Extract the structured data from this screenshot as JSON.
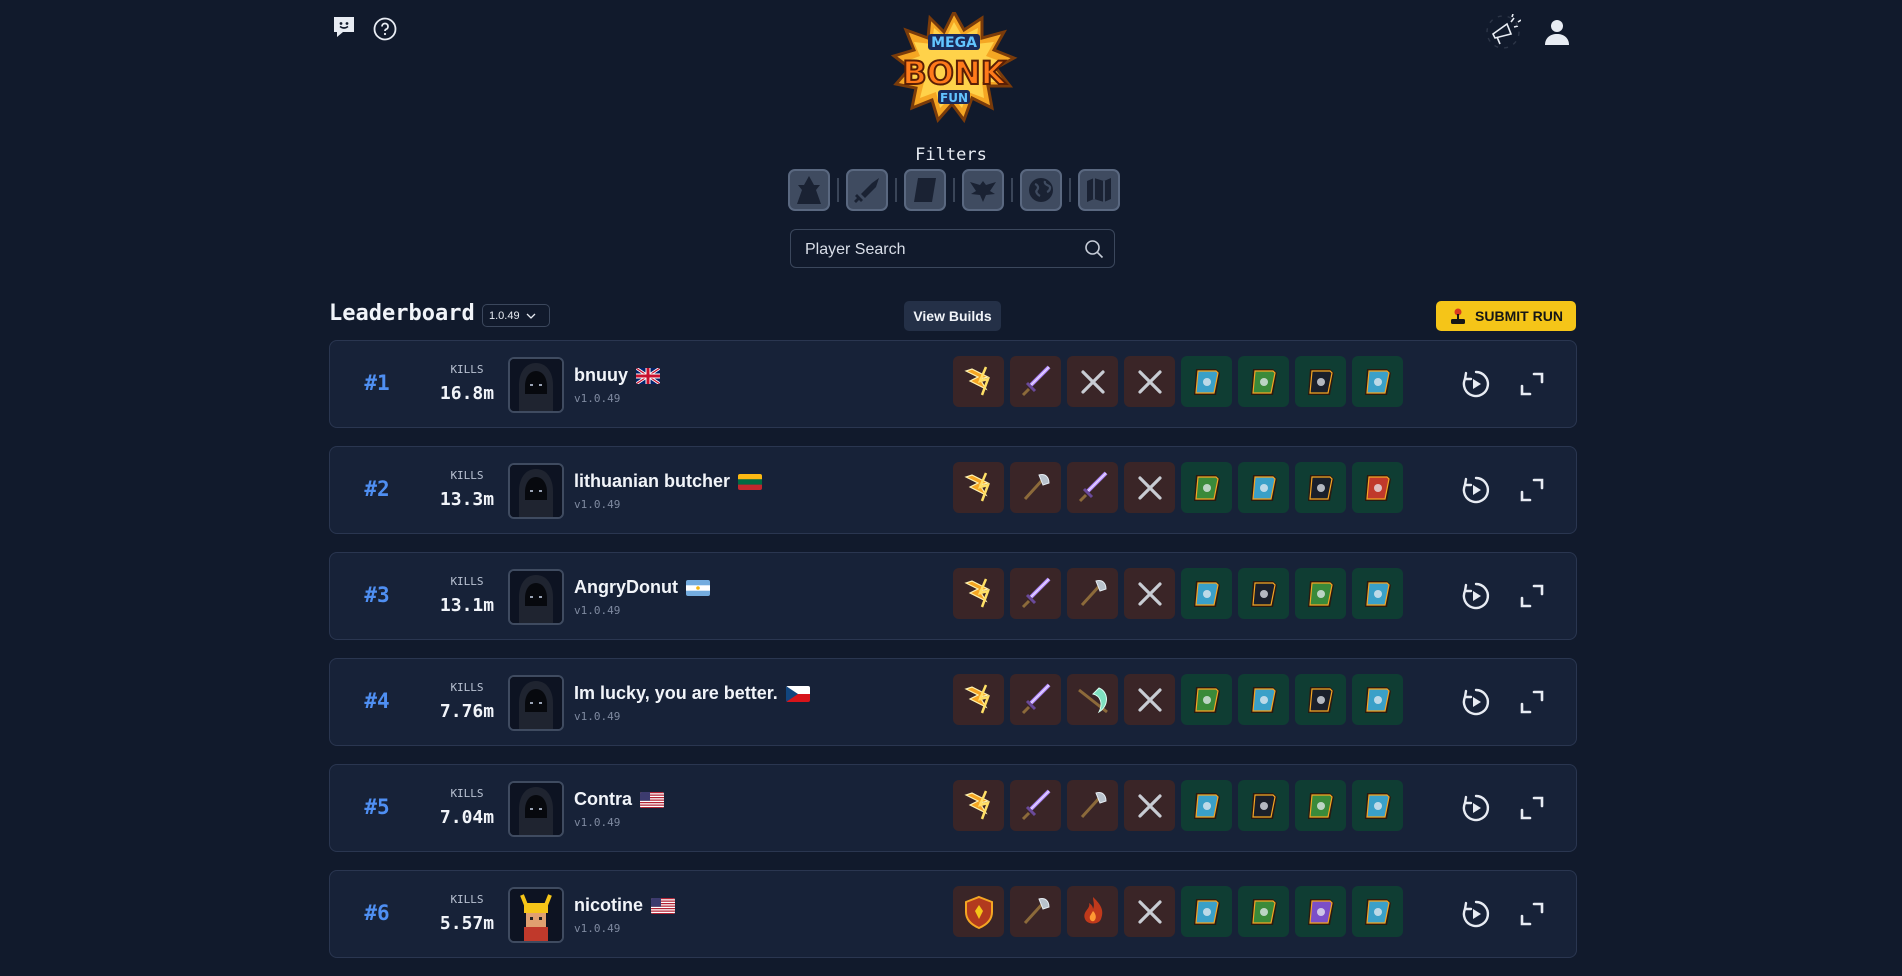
{
  "header": {
    "chat_icon": "chat-bubble-icon",
    "help_icon": "help-circle-icon",
    "announcement_icon": "megaphone-icon",
    "profile_icon": "user-icon",
    "logo": {
      "line1": "MEGA",
      "line2": "BONK",
      "line3": "FUN"
    }
  },
  "filters": {
    "label": "Filters",
    "buttons": [
      {
        "name": "character-filter",
        "icon": "character-icon"
      },
      {
        "name": "weapon-filter",
        "icon": "sword-icon"
      },
      {
        "name": "tome-filter",
        "icon": "tome-icon"
      },
      {
        "name": "item-filter",
        "icon": "bird-icon"
      },
      {
        "name": "world-filter",
        "icon": "globe-icon"
      },
      {
        "name": "map-filter",
        "icon": "map-icon"
      }
    ]
  },
  "search": {
    "placeholder": "Player Search"
  },
  "leaderboard": {
    "title": "Leaderboard",
    "version": "1.0.49",
    "view_builds": "View Builds",
    "submit_run": "SUBMIT RUN",
    "kills_label": "KILLS",
    "rows": [
      {
        "rank": "#1",
        "kills": "16.8m",
        "name": "bnuuy",
        "flag": "gb",
        "version": "v1.0.49",
        "avatar": "hood",
        "weapons": [
          "lightning",
          "sword",
          "empty",
          "empty"
        ],
        "tomes": [
          "blue",
          "green",
          "dark",
          "blue"
        ]
      },
      {
        "rank": "#2",
        "kills": "13.3m",
        "name": "lithuanian butcher",
        "flag": "lt",
        "version": "v1.0.49",
        "avatar": "hood",
        "weapons": [
          "lightning",
          "axe",
          "sword",
          "empty"
        ],
        "tomes": [
          "green",
          "blue",
          "dark",
          "red"
        ]
      },
      {
        "rank": "#3",
        "kills": "13.1m",
        "name": "AngryDonut",
        "flag": "ar",
        "version": "v1.0.49",
        "avatar": "hood",
        "weapons": [
          "lightning",
          "sword",
          "axe",
          "empty"
        ],
        "tomes": [
          "blue",
          "dark",
          "green",
          "blue"
        ]
      },
      {
        "rank": "#4",
        "kills": "7.76m",
        "name": "Im lucky, you are better.",
        "flag": "cz",
        "version": "v1.0.49",
        "avatar": "hood",
        "weapons": [
          "lightning",
          "sword",
          "scythe",
          "empty"
        ],
        "tomes": [
          "green",
          "blue",
          "dark",
          "blue"
        ]
      },
      {
        "rank": "#5",
        "kills": "7.04m",
        "name": "Contra",
        "flag": "us",
        "version": "v1.0.49",
        "avatar": "hood",
        "weapons": [
          "lightning",
          "sword",
          "axe",
          "empty"
        ],
        "tomes": [
          "blue",
          "dark",
          "green",
          "blue"
        ]
      },
      {
        "rank": "#6",
        "kills": "5.57m",
        "name": "nicotine",
        "flag": "us",
        "version": "v1.0.49",
        "avatar": "viking",
        "weapons": [
          "shield",
          "axe",
          "fire",
          "empty"
        ],
        "tomes": [
          "blue",
          "green",
          "purple",
          "blue"
        ]
      }
    ]
  },
  "colors": {
    "accent": "#4f8ff2",
    "submit": "#f5c518",
    "background": "#111a2c"
  }
}
